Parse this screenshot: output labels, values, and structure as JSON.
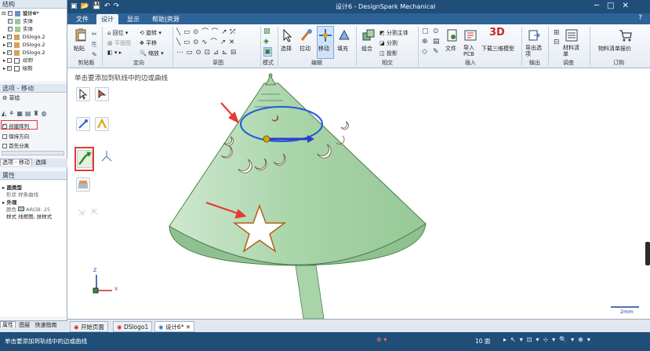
{
  "app": {
    "title": "设计6 - DesignSpark Mechanical",
    "file_menu": "文件",
    "tabs": [
      "设计",
      "显示",
      "帮助|资源"
    ]
  },
  "structure": {
    "title": "结构",
    "items": [
      {
        "label": "设计6*",
        "bold": true
      },
      {
        "label": "实体"
      },
      {
        "label": "实体"
      },
      {
        "label": "DSlogo.2"
      },
      {
        "label": "DSlogo.2"
      },
      {
        "label": "DSlogo.2"
      },
      {
        "label": "绘制"
      },
      {
        "label": "绘制"
      }
    ]
  },
  "options": {
    "title": "选项 - 移动",
    "section": "草绘",
    "checks": [
      {
        "label": "创建阵列",
        "checked": true
      },
      {
        "label": "保持方向",
        "checked": false
      },
      {
        "label": "首先分离",
        "checked": false
      }
    ],
    "bottom_tabs": [
      "选项 - 移动",
      "选择"
    ]
  },
  "properties": {
    "title": "属性",
    "rows": [
      {
        "key": "面类型",
        "value": "",
        "header": true
      },
      {
        "key": "形状",
        "value": "样条曲线"
      },
      {
        "key": "外观",
        "value": "",
        "header": true
      },
      {
        "key": "颜色",
        "value": "ARGB: 25"
      },
      {
        "key": "样式",
        "value": "线框图, 扶样式"
      }
    ]
  },
  "left_bottom_tabs": [
    "属性",
    "图层",
    "快速指南"
  ],
  "ribbon": {
    "groups": [
      {
        "name": "剪贴板",
        "buttons": [
          "粘贴"
        ]
      },
      {
        "name": "定向",
        "buttons": [
          "回位",
          "平移",
          "平面图",
          "缩放",
          "旋转"
        ]
      },
      {
        "name": "草图",
        "buttons": []
      },
      {
        "name": "模式",
        "buttons": []
      },
      {
        "name": "编辑",
        "buttons": [
          "选择",
          "拉动",
          "移动",
          "填充"
        ]
      },
      {
        "name": "相交",
        "buttons": [
          "组合",
          "分割主体",
          "分割",
          "投影"
        ]
      },
      {
        "name": "插入",
        "buttons": [
          "文件",
          "导入PCB",
          "下载三维模型"
        ]
      },
      {
        "name": "输出",
        "buttons": [
          "导出选项"
        ]
      },
      {
        "name": "调查",
        "buttons": [
          "材料清单"
        ]
      },
      {
        "name": "订购",
        "buttons": [
          "物料清单报价"
        ]
      }
    ]
  },
  "canvas": {
    "hint": "单击要添加到轨线中的边或曲线",
    "scale_label": "2mm",
    "axis_labels": [
      "Z",
      "X"
    ]
  },
  "doc_tabs": [
    {
      "label": "开始页面",
      "active": false
    },
    {
      "label": "DSlogo1",
      "active": false
    },
    {
      "label": "设计6*",
      "active": true
    }
  ],
  "status": {
    "message": "单击要添加到轨线中的边或曲线",
    "selection": "10 面"
  },
  "colors": {
    "titlebar": "#1f4e79",
    "ribbon_tab": "#2e6398",
    "model_green": "#a8d4a8",
    "annotation_red": "#e53935",
    "path_blue": "#1e5bd6"
  }
}
